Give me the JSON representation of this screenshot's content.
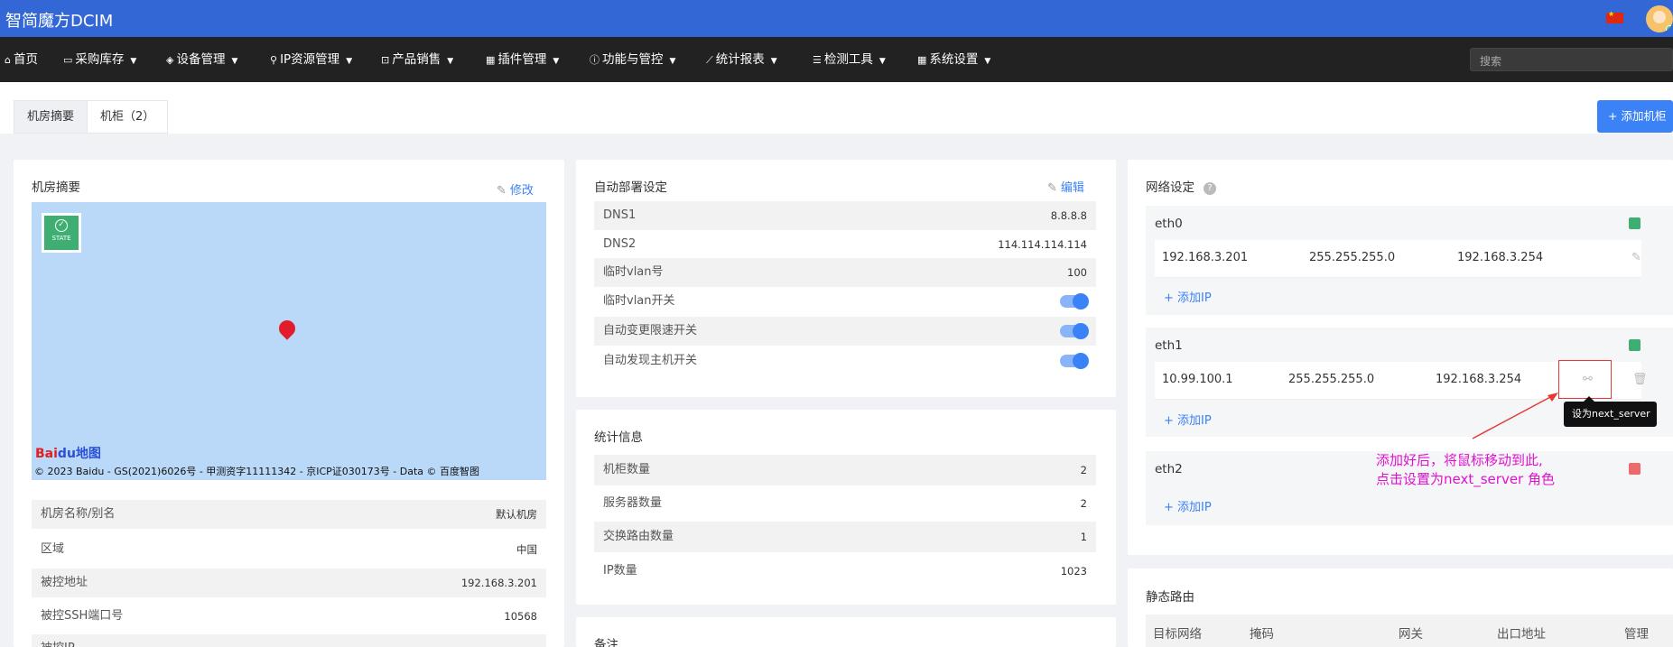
{
  "app": {
    "brand": "智简魔方DCIM"
  },
  "nav": [
    {
      "icon": "home-icon",
      "glyph": "⌂",
      "label": "首页",
      "caret": false
    },
    {
      "icon": "inbox-icon",
      "glyph": "▭",
      "label": "采购库存",
      "caret": true
    },
    {
      "icon": "cube-icon",
      "glyph": "◈",
      "label": "设备管理",
      "caret": true
    },
    {
      "icon": "map-marker-icon",
      "glyph": "⚲",
      "label": "IP资源管理",
      "caret": true
    },
    {
      "icon": "cart-icon",
      "glyph": "⊡",
      "label": "产品销售",
      "caret": true
    },
    {
      "icon": "grid-icon",
      "glyph": "▦",
      "label": "插件管理",
      "caret": true
    },
    {
      "icon": "info-icon",
      "glyph": "ⓘ",
      "label": "功能与管控",
      "caret": true
    },
    {
      "icon": "line-chart-icon",
      "glyph": "⟋",
      "label": "统计报表",
      "caret": true
    },
    {
      "icon": "list-icon",
      "glyph": "☰",
      "label": "检测工具",
      "caret": true
    },
    {
      "icon": "settings-grid-icon",
      "glyph": "▦",
      "label": "系统设置",
      "caret": true
    }
  ],
  "search": {
    "placeholder": "搜索"
  },
  "tabs": {
    "summary": "机房摘要",
    "cabinet": "机柜（2）"
  },
  "add_cabinet": "+ 添加机柜",
  "summary_card": {
    "title": "机房摘要",
    "edit": "修改",
    "map": {
      "badge": "STATE",
      "logo_left": "Bai",
      "logo_paw": "du",
      "logo_right": "地图",
      "attribution": "© 2023 Baidu - GS(2021)6026号 - 甲测资字11111342 - 京ICP证030173号 - Data © 百度智图"
    },
    "rows": [
      {
        "k": "机房名称/别名",
        "v": "默认机房"
      },
      {
        "k": "区域",
        "v": "中国"
      },
      {
        "k": "被控地址",
        "v": "192.168.3.201"
      },
      {
        "k": "被控SSH端口号",
        "v": "10568"
      },
      {
        "k": "被控IP",
        "v": ""
      }
    ]
  },
  "deploy_card": {
    "title": "自动部署设定",
    "edit": "编辑",
    "rows": [
      {
        "k": "DNS1",
        "v": "8.8.8.8"
      },
      {
        "k": "DNS2",
        "v": "114.114.114.114"
      },
      {
        "k": "临时vlan号",
        "v": "100"
      }
    ],
    "toggles": [
      {
        "k": "临时vlan开关",
        "on": true
      },
      {
        "k": "自动变更限速开关",
        "on": true
      },
      {
        "k": "自动发现主机开关",
        "on": true
      }
    ]
  },
  "stats_card": {
    "title": "统计信息",
    "rows": [
      {
        "k": "机柜数量",
        "v": "2"
      },
      {
        "k": "服务器数量",
        "v": "2"
      },
      {
        "k": "交换路由数量",
        "v": "1"
      },
      {
        "k": "IP数量",
        "v": "1023"
      }
    ]
  },
  "notes_card": {
    "title": "备注"
  },
  "network_card": {
    "title": "网络设定",
    "help": "?",
    "add_ip": "+ 添加IP",
    "interfaces": [
      {
        "name": "eth0",
        "status_color": "#3fae72",
        "ip": "192.168.3.201",
        "mask": "255.255.255.0",
        "gateway": "192.168.3.254"
      },
      {
        "name": "eth1",
        "status_color": "#3fae72",
        "ip": "10.99.100.1",
        "mask": "255.255.255.0",
        "gateway": "192.168.3.254"
      },
      {
        "name": "eth2",
        "status_color": "#ee6a6a"
      }
    ],
    "tooltip": "设为next_server"
  },
  "annotation": {
    "line1": "添加好后，将鼠标移动到此,",
    "line2": "点击设置为next_server 角色",
    "color": "#e012d0"
  },
  "routes_card": {
    "title": "静态路由",
    "columns": [
      "目标网络",
      "掩码",
      "网关",
      "出口地址",
      "管理"
    ]
  },
  "colors": {
    "topbar": "#3367d6",
    "navbar": "#222222",
    "accent": "#3b82f6"
  }
}
